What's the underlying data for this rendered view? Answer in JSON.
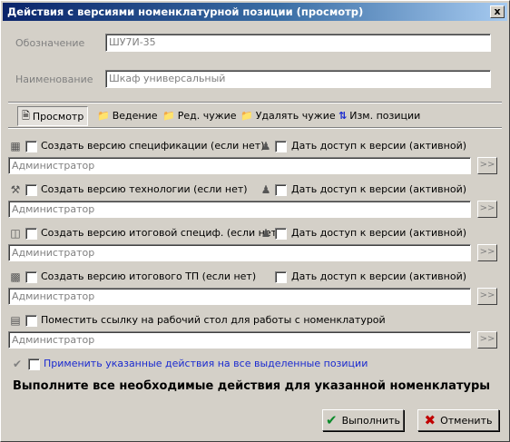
{
  "window": {
    "title": "Действия с версиями номенклатурной позиции (просмотр)",
    "close": "x"
  },
  "fields": {
    "designation_label": "Обозначение",
    "designation_value": "ШУ7И-35",
    "name_label": "Наименование",
    "name_value": "Шкаф универсальный"
  },
  "toolbar": {
    "view": "Просмотр",
    "lead": "Ведение",
    "edit_foreign": "Ред. чужие",
    "delete_foreign": "Удалять чужие",
    "change_position": "Изм. позиции"
  },
  "rows": [
    {
      "create_label": "Создать версию спецификации (если нет)",
      "access_label": "Дать доступ к версии (активной)",
      "user": "Администратор"
    },
    {
      "create_label": "Создать версию технологии (если нет)",
      "access_label": "Дать доступ к версии (активной)",
      "user": "Администратор"
    },
    {
      "create_label": "Создать версию итоговой специф. (если нет)",
      "access_label": "Дать доступ к версии (активной)",
      "user": "Администратор"
    },
    {
      "create_label": "Создать версию итогового ТП (если нет)",
      "access_label": "Дать доступ к версии (активной)",
      "user": "Администратор"
    },
    {
      "create_label": "Поместить ссылку на рабочий стол для работы с номенклатурой",
      "user": "Администратор"
    }
  ],
  "browse_button": ">>",
  "apply_all_label": "Применить указанные действия на все выделенные позиции",
  "instruction": "Выполните все необходимые действия для  указанной номенклатуры",
  "buttons": {
    "ok": "Выполнить",
    "cancel": "Отменить"
  },
  "colors": {
    "title_start": "#0a246a",
    "title_end": "#a6caf0",
    "face": "#d4d0c8",
    "apply_text": "#1a2ad0"
  }
}
